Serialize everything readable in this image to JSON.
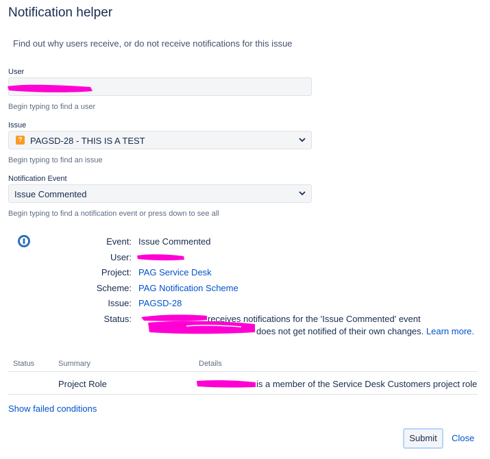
{
  "dialog": {
    "title": "Notification helper",
    "subtitle": "Find out why users receive, or do not receive notifications for this issue"
  },
  "form": {
    "user": {
      "label": "User",
      "value": "",
      "help": "Begin typing to find a user"
    },
    "issue": {
      "label": "Issue",
      "value": "PAGSD-28 - THIS IS A TEST",
      "icon": "question-issue-icon",
      "help": "Begin typing to find an issue"
    },
    "event": {
      "label": "Notification Event",
      "value": "Issue Commented",
      "help": "Begin typing to find a notification event or press down to see all"
    }
  },
  "result": {
    "icon": "info-icon",
    "event_label": "Event:",
    "event_value": "Issue Commented",
    "user_label": "User:",
    "project_label": "Project:",
    "project_value": "PAG Service Desk",
    "scheme_label": "Scheme:",
    "scheme_value": "PAG Notification Scheme",
    "issue_label": "Issue:",
    "issue_value": "PAGSD-28",
    "status_label": "Status:",
    "status_line1": "receives notifications for the 'Issue Commented' event",
    "status_line2_prefix": "does not get notified of their own changes.",
    "learn_more": "Learn more."
  },
  "table": {
    "headers": [
      "Status",
      "Summary",
      "Details"
    ],
    "rows": [
      {
        "status": "",
        "summary": "Project Role",
        "details": "is a member of the Service Desk Customers project role"
      }
    ]
  },
  "show_failed": "Show failed conditions",
  "footer": {
    "submit": "Submit",
    "close": "Close"
  },
  "colors": {
    "redaction": "#ff00d4",
    "link": "#0052cc",
    "field_bg": "#f4f5f7"
  }
}
